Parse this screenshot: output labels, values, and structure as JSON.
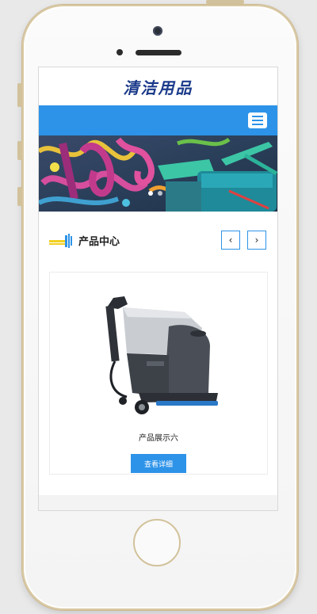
{
  "site": {
    "logo_text": "清洁用品"
  },
  "nav": {
    "menu_icon": "hamburger-menu-icon"
  },
  "banner": {
    "slides_total": 2,
    "active_slide": 1
  },
  "section": {
    "title": "产品中心",
    "prev_symbol": "‹",
    "next_symbol": "›"
  },
  "product": {
    "name": "产品展示六",
    "button_label": "查看详细"
  },
  "colors": {
    "accent": "#2d93e8",
    "logo": "#1b3a8a"
  }
}
